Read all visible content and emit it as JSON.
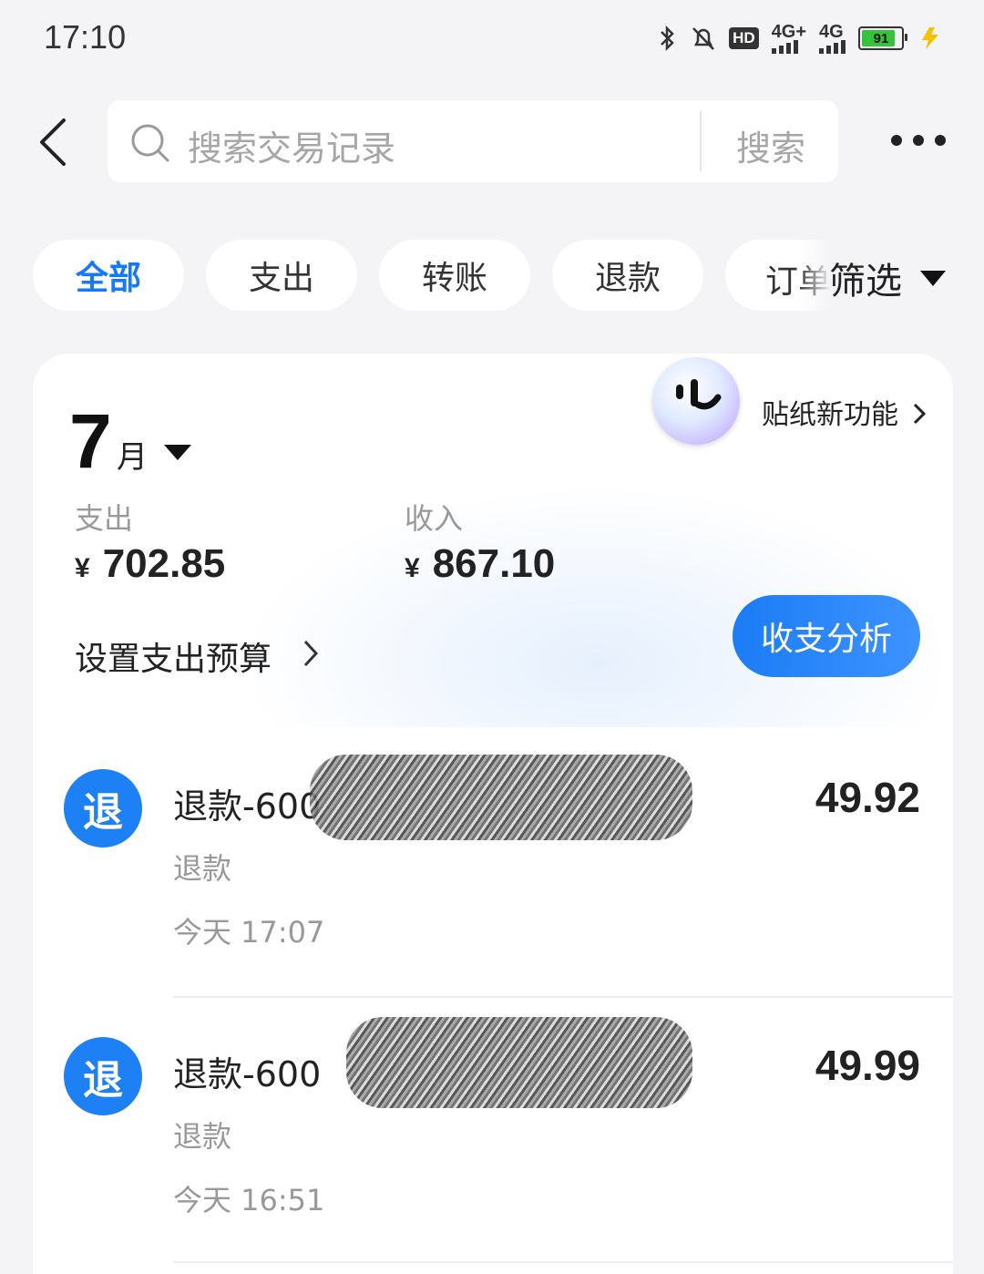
{
  "status_bar": {
    "time": "17:10",
    "network1": "4G+",
    "network2": "4G",
    "hd_label": "HD",
    "battery": "91"
  },
  "header": {
    "search_placeholder": "搜索交易记录",
    "search_button": "搜索"
  },
  "filters": {
    "chips": [
      "全部",
      "支出",
      "转账",
      "退款",
      "订单"
    ],
    "active_index": 0,
    "filter_label": "筛选"
  },
  "summary": {
    "month_num": "7",
    "month_unit": "月",
    "expense_label": "支出",
    "expense_currency": "¥",
    "expense_amount": "702.85",
    "income_label": "收入",
    "income_currency": "¥",
    "income_amount": "867.10",
    "budget_label": "设置支出预算",
    "analysis_button": "收支分析",
    "sticker_label": "贴纸新功能"
  },
  "transactions": [
    {
      "icon_text": "退",
      "title": "退款-600",
      "category": "退款",
      "time": "今天 17:07",
      "amount": "49.92"
    },
    {
      "icon_text": "退",
      "title": "退款-600",
      "category": "退款",
      "time": "今天 16:51",
      "amount": "49.99"
    }
  ],
  "colors": {
    "accent": "#1677ff",
    "background": "#f4f4f6",
    "icon_blue": "#1d80f5"
  }
}
